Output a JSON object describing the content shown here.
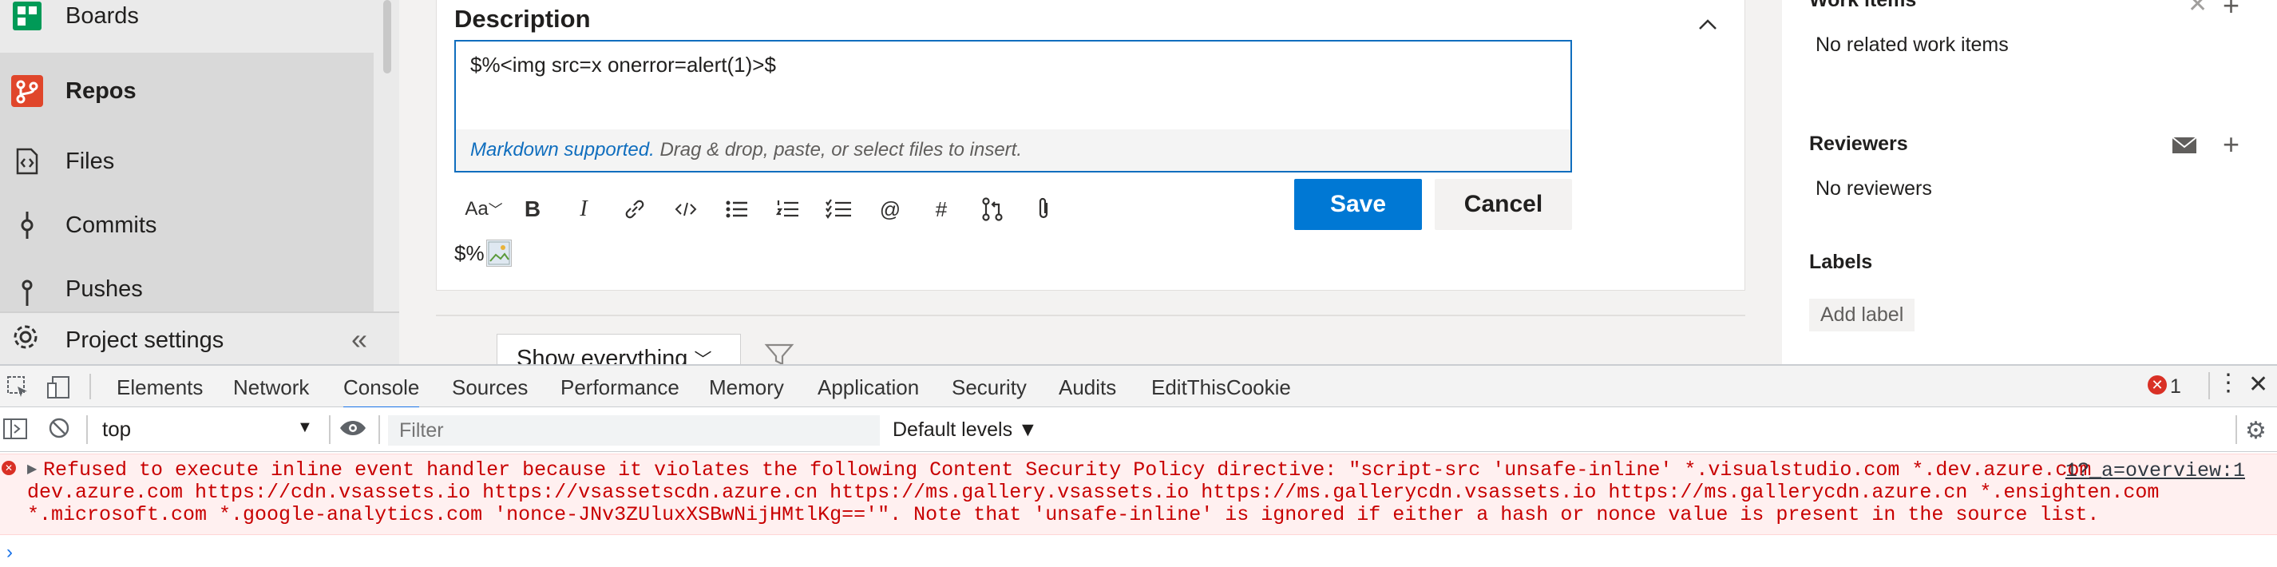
{
  "sidebar": {
    "items": [
      {
        "label": "Boards"
      },
      {
        "label": "Repos"
      },
      {
        "label": "Files"
      },
      {
        "label": "Commits"
      },
      {
        "label": "Pushes"
      }
    ],
    "project_settings": "Project settings",
    "collapse_glyph": "«"
  },
  "description": {
    "title": "Description",
    "editor_value": "$%<img src=x onerror=alert(1)>$",
    "markdown_link": "Markdown supported.",
    "footer_hint": " Drag & drop, paste, or select files to insert.",
    "toolbar": [
      "Aa",
      "B",
      "I"
    ],
    "save_label": "Save",
    "cancel_label": "Cancel",
    "preview_prefix": "$%"
  },
  "filter": {
    "label": "Show everything"
  },
  "right_panel": {
    "work_items_header": "Work items",
    "work_items_empty": "No related work items",
    "reviewers_header": "Reviewers",
    "reviewers_empty": "No reviewers",
    "labels_header": "Labels",
    "add_label": "Add label"
  },
  "devtools": {
    "tabs": [
      "Elements",
      "Network",
      "Console",
      "Sources",
      "Performance",
      "Memory",
      "Application",
      "Security",
      "Audits",
      "EditThisCookie"
    ],
    "active_tab": "Console",
    "error_count": "1",
    "context": "top",
    "filter_placeholder": "Filter",
    "levels": "Default levels ▼",
    "error_lines": [
      "Refused to execute inline event handler because it violates the following Content Security Policy directive: \"script-src 'unsafe-inline' *.visualstudio.com *.dev.azure.com",
      "dev.azure.com https://cdn.vsassets.io https://vsassetscdn.azure.cn https://ms.gallery.vsassets.io https://ms.gallerycdn.vsassets.io https://ms.gallerycdn.azure.cn *.ensighten.com",
      "*.microsoft.com *.google-analytics.com 'nonce-JNv3ZUluxXSBwNijHMtlKg=='\". Note that 'unsafe-inline' is ignored if either a hash or nonce value is present in the source list."
    ],
    "error_source": "1?_a=overview:1",
    "prompt": "›"
  },
  "colors": {
    "accent": "#0078d4",
    "error": "#c80000",
    "repos": "#e0462b",
    "boards": "#009a57"
  }
}
